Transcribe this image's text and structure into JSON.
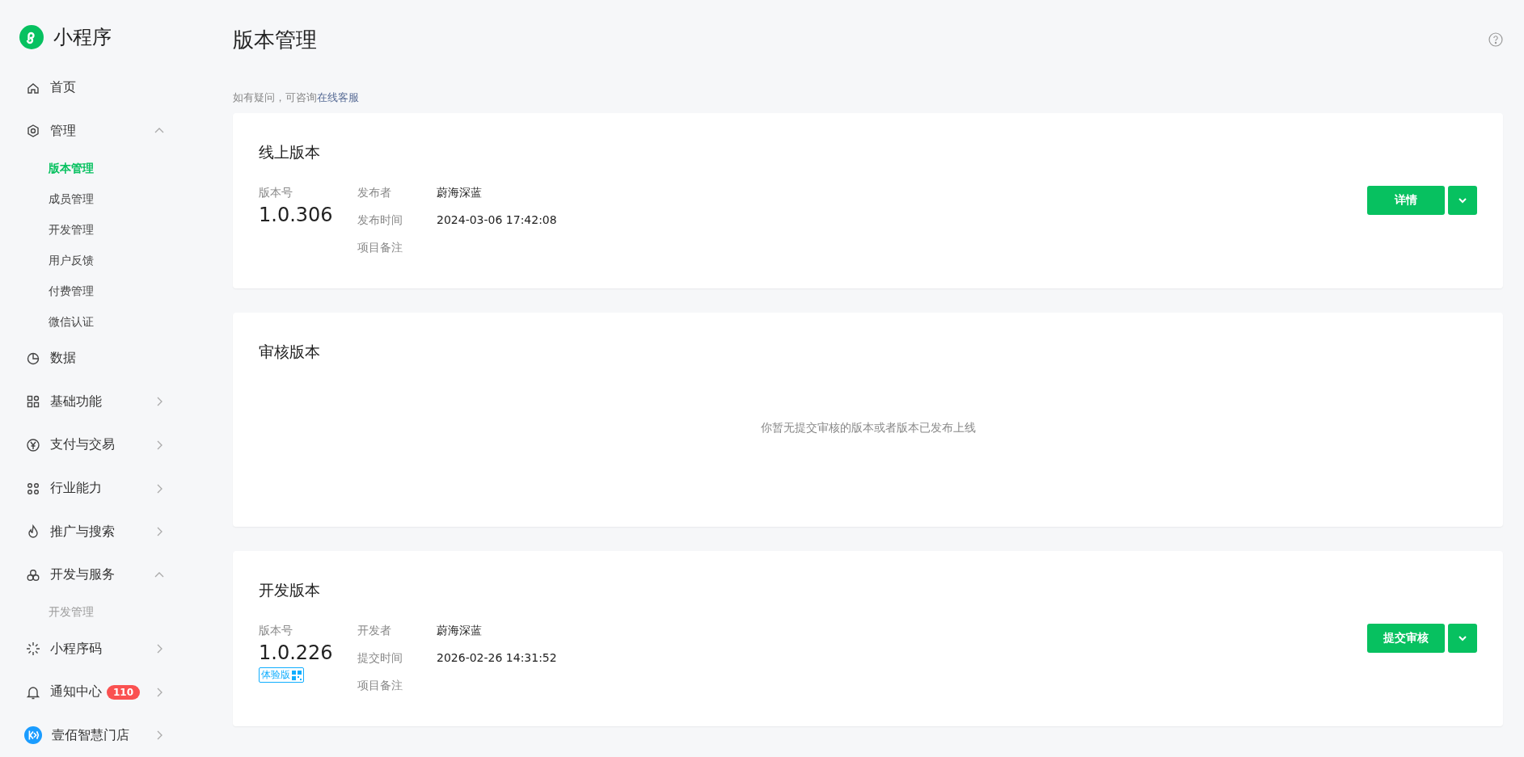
{
  "sidebar": {
    "logo_text": "小程序",
    "items": [
      {
        "label": "首页"
      },
      {
        "label": "管理",
        "expanded": true,
        "children": [
          {
            "label": "版本管理",
            "selected": true,
            "disabled": false
          },
          {
            "label": "成员管理",
            "selected": false,
            "disabled": false
          },
          {
            "label": "开发管理",
            "selected": false,
            "disabled": false
          },
          {
            "label": "用户反馈",
            "selected": false,
            "disabled": false
          },
          {
            "label": "付费管理",
            "selected": false,
            "disabled": false
          },
          {
            "label": "微信认证",
            "selected": false,
            "disabled": false
          }
        ]
      },
      {
        "label": "数据"
      },
      {
        "label": "基础功能",
        "expanded": false
      },
      {
        "label": "支付与交易",
        "expanded": false
      },
      {
        "label": "行业能力",
        "expanded": false
      },
      {
        "label": "推广与搜索",
        "expanded": false
      },
      {
        "label": "开发与服务",
        "expanded": true,
        "children": [
          {
            "label": "开发管理",
            "selected": false,
            "disabled": true
          }
        ]
      },
      {
        "label": "小程序码",
        "expanded": false
      },
      {
        "label": "通知中心",
        "expanded": false,
        "badge": "110"
      },
      {
        "label": "壹佰智慧门店",
        "expanded": false
      }
    ]
  },
  "main": {
    "title": "版本管理",
    "hint": {
      "text": "如有疑问，可咨询",
      "link": "在线客服"
    },
    "cards": [
      {
        "kind": "version",
        "title": "线上版本",
        "version_label": "版本号",
        "version": "1.0.306",
        "fields": [
          {
            "label": "发布者",
            "value": "蔚海深蓝"
          },
          {
            "label": "发布时间",
            "value": "2024-03-06 17:42:08"
          },
          {
            "label": "项目备注"
          }
        ],
        "button": "详情"
      },
      {
        "kind": "empty",
        "title": "审核版本",
        "message": "你暂无提交审核的版本或者版本已发布上线"
      },
      {
        "kind": "version",
        "title": "开发版本",
        "version_label": "版本号",
        "version": "1.0.226",
        "tag": "体验版",
        "fields": [
          {
            "label": "开发者",
            "value": "蔚海深蓝"
          },
          {
            "label": "提交时间",
            "value": "2026-02-26 14:31:52"
          },
          {
            "label": "项目备注"
          }
        ],
        "button": "提交审核"
      }
    ]
  }
}
